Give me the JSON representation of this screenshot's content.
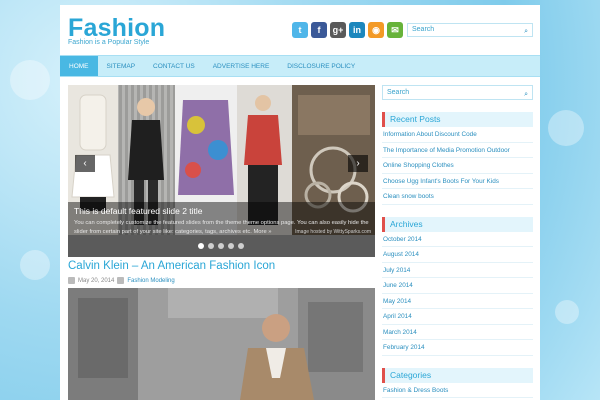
{
  "header": {
    "site_title": "Fashion",
    "tagline": "Fashion is a Popular Style",
    "search_placeholder": "Search",
    "social_icons": [
      {
        "name": "twitter-icon",
        "glyph": "t",
        "color": "#4fb6e9"
      },
      {
        "name": "facebook-icon",
        "glyph": "f",
        "color": "#3b5998"
      },
      {
        "name": "googleplus-icon",
        "glyph": "g+",
        "color": "#5a5a5a"
      },
      {
        "name": "linkedin-icon",
        "glyph": "in",
        "color": "#1c87bd"
      },
      {
        "name": "rss-icon",
        "glyph": "◉",
        "color": "#f39a26"
      },
      {
        "name": "email-icon",
        "glyph": "✉",
        "color": "#67b33a"
      }
    ]
  },
  "nav": {
    "items": [
      "Home",
      "Sitemap",
      "Contact Us",
      "Advertise Here",
      "Disclosure Policy"
    ],
    "active_index": 0
  },
  "slider": {
    "title": "This is default featured slide 2 title",
    "text": "You can completely customize the featured slides from the theme theme options page. You can also easily hide the slider from certain part of your site like: categories, tags, archives etc. More »",
    "credit": "Image hosted by WittySparks.com",
    "dot_count": 5,
    "active_dot": 0,
    "prev_label": "‹",
    "next_label": "›"
  },
  "post": {
    "title": "Calvin Klein – An American Fashion Icon",
    "date": "May 20, 2014",
    "category": "Fashion Modeling"
  },
  "sidebar": {
    "search_placeholder": "Search",
    "recent_posts_title": "Recent Posts",
    "recent_posts": [
      "Information About Discount Code",
      "The Importance of Media Promotion Outdoor",
      "Online Shopping Clothes",
      "Choose Ugg Infant's Boots For Your Kids",
      "Clean snow boots"
    ],
    "archives_title": "Archives",
    "archives": [
      "October 2014",
      "August 2014",
      "July 2014",
      "June 2014",
      "May 2014",
      "April 2014",
      "March 2014",
      "February 2014"
    ],
    "categories_title": "Categories",
    "categories": [
      "Fashion & Dress Boots"
    ]
  },
  "colors": {
    "accent": "#2aa6d6",
    "nav_background": "#c7edf9",
    "nav_active": "#49b8e3",
    "widget_marker": "#e0504b"
  }
}
